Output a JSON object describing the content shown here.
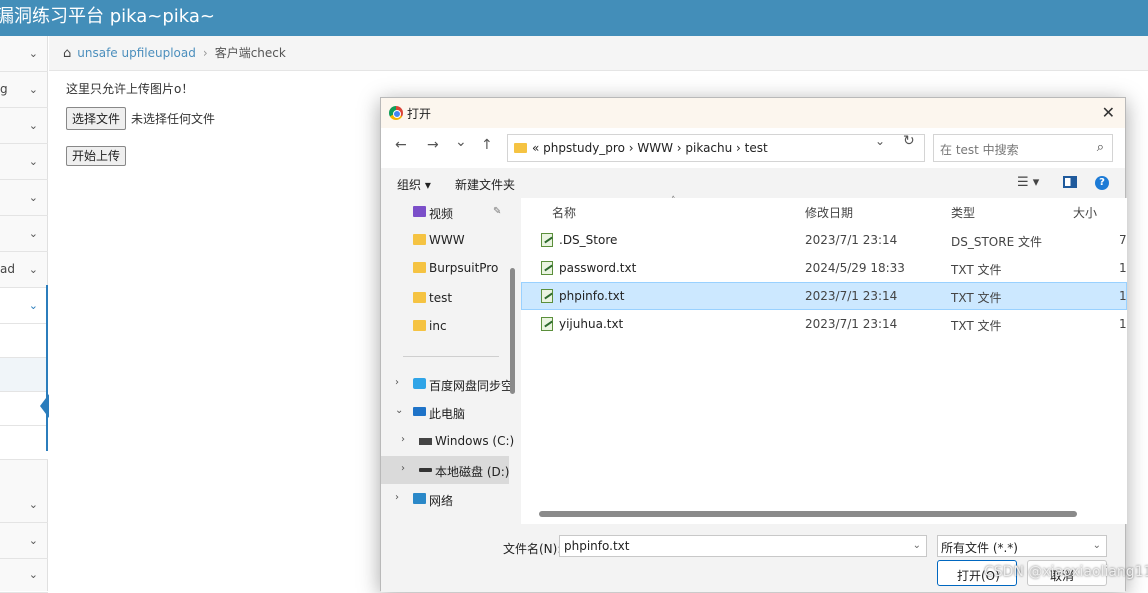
{
  "header": {
    "title": "漏洞练习平台 pika~pika~",
    "bg_color": "#438eb9"
  },
  "sidebar": {
    "rows": [
      {
        "label": "",
        "icon": "chevron-down-icon"
      },
      {
        "label": "g",
        "icon": "chevron-down-icon"
      },
      {
        "label": "",
        "icon": "chevron-down-icon"
      },
      {
        "label": "",
        "icon": "chevron-down-icon"
      },
      {
        "label": "",
        "icon": "chevron-down-icon"
      },
      {
        "label": "",
        "icon": "chevron-down-icon"
      },
      {
        "label": "ad",
        "icon": "chevron-down-icon"
      },
      {
        "label": "",
        "icon": "chevron-down-icon"
      },
      {
        "label": "",
        "icon": "chevron-down-icon"
      },
      {
        "label": "",
        "icon": "chevron-down-icon"
      },
      {
        "label": "",
        "icon": "chevron-down-icon"
      }
    ],
    "accent_color": "#2b7dbc"
  },
  "breadcrumb": {
    "link": "unsafe upfileupload",
    "separator": "›",
    "current": "客户端check"
  },
  "main": {
    "notice": "这里只允许上传图片o！",
    "choose_file_label": "选择文件",
    "file_status": "未选择任何文件",
    "upload_label": "开始上传"
  },
  "dialog": {
    "title": "打开",
    "close": "✕",
    "nav": {
      "back": "←",
      "forward": "→",
      "recent": "⌄",
      "up": "↑"
    },
    "address": {
      "prefix": "«",
      "path": "phpstudy_pro  ›  WWW  ›  pikachu  ›  test",
      "chevron": "⌄",
      "refresh": "↻"
    },
    "search": {
      "placeholder": "在 test 中搜索",
      "icon": "⌕"
    },
    "toolbar": {
      "organize": "组织 ▾",
      "new_folder": "新建文件夹",
      "view": "☰ ▾"
    },
    "nav_pane": [
      {
        "label": "视频",
        "icon": "video",
        "pinned": true
      },
      {
        "label": "WWW",
        "icon": "folder"
      },
      {
        "label": "BurpsuitPro",
        "icon": "folder"
      },
      {
        "label": "test",
        "icon": "folder"
      },
      {
        "label": "inc",
        "icon": "folder"
      },
      {
        "label": "百度网盘同步空",
        "icon": "cloud",
        "expander": "›"
      },
      {
        "label": "此电脑",
        "icon": "pc",
        "expander": "⌄"
      },
      {
        "label": "Windows (C:)",
        "icon": "win",
        "expander": "›"
      },
      {
        "label": "本地磁盘 (D:)",
        "icon": "drive",
        "expander": "›"
      },
      {
        "label": "网络",
        "icon": "net",
        "expander": "›"
      }
    ],
    "columns": {
      "name": "名称",
      "date": "修改日期",
      "type": "类型",
      "size": "大小"
    },
    "files": [
      {
        "name": ".DS_Store",
        "date": "2023/7/1 23:14",
        "type": "DS_STORE 文件",
        "size": "7"
      },
      {
        "name": "password.txt",
        "date": "2024/5/29 18:33",
        "type": "TXT 文件",
        "size": "1"
      },
      {
        "name": "phpinfo.txt",
        "date": "2023/7/1 23:14",
        "type": "TXT 文件",
        "size": "1"
      },
      {
        "name": "yijuhua.txt",
        "date": "2023/7/1 23:14",
        "type": "TXT 文件",
        "size": "1"
      }
    ],
    "filename_label": "文件名(N):",
    "filename_value": "phpinfo.txt",
    "filetype_value": "所有文件 (*.*)",
    "open_label": "打开(O)",
    "cancel_label": "取消"
  },
  "watermark": "CSDN @xiaoxiaoliang11"
}
